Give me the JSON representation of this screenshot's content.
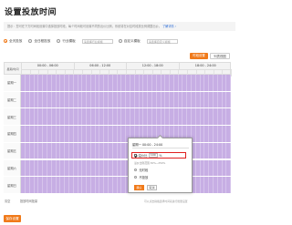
{
  "page": {
    "title": "设置投放时间",
    "notice": "提示：您可在下方时间段设置中选择投放时段，每个时间段可设置不同的出价比例，系统将在对应时段按比例调整出价。",
    "notice_link": "了解详情 ›"
  },
  "modes": [
    {
      "label": "全天投放",
      "selected": true
    },
    {
      "label": "全日程投放",
      "selected": false
    },
    {
      "label": "行业模板",
      "selected": false
    },
    {
      "label": "自定义模板",
      "selected": false
    }
  ],
  "selects": {
    "industry_placeholder": "请选择行业模板",
    "custom_placeholder": "请选择自定义模板"
  },
  "actions": {
    "batch_label": "时段设置",
    "list_label": "列表视图"
  },
  "schedule": {
    "corner_label": "星期/时间",
    "segments": [
      "00:00 - 06:00",
      "06:00 - 12:00",
      "12:00 - 18:00",
      "18:00 - 24:00"
    ],
    "days": [
      "星期一",
      "星期二",
      "星期三",
      "星期四",
      "星期五",
      "星期六",
      "星期日"
    ],
    "selected_color": "#c7aee4"
  },
  "bottom": {
    "clear_label": "清空",
    "select_all_label": "投放时间批量",
    "note": "可以点击拖拽选择时间段进行批量设置"
  },
  "popup": {
    "title": "星期一 00:00 - 24:00",
    "discount_label": "溢价比",
    "discount_value": "100",
    "discount_unit": "%",
    "hint": "溢价比例范围 30%~250%",
    "option_a": "无时段",
    "option_b": "不投放",
    "ok_label": "确认",
    "cancel_label": "取消"
  },
  "footer": {
    "save_label": "保存设置"
  },
  "colors": {
    "accent": "#f07a1a",
    "grid_fill": "#c7aee4",
    "highlight_border": "#e02020"
  }
}
